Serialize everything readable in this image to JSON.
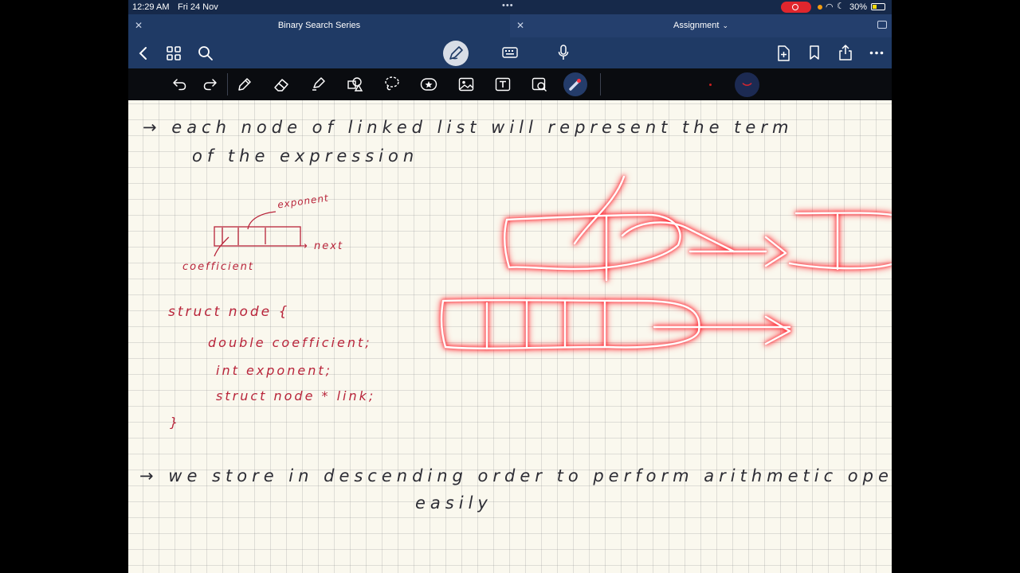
{
  "status_bar": {
    "time": "12:29 AM",
    "date": "Fri 24 Nov",
    "battery": "30%",
    "battery_level": 0.3
  },
  "tabs": [
    {
      "label": "Binary Search Series",
      "active": false
    },
    {
      "label": "Assignment",
      "active": true
    }
  ],
  "toolbar": {
    "icons": [
      "back-icon",
      "grid-icon",
      "search-icon",
      "pen-mode-icon",
      "keyboard-icon",
      "microphone-icon",
      "add-page-icon",
      "bookmark-icon",
      "share-icon",
      "more-icon"
    ]
  },
  "drawing_tools": {
    "icons": [
      "undo-icon",
      "redo-icon",
      "pencil-icon",
      "eraser-icon",
      "highlighter-icon",
      "shapes-icon",
      "lasso-icon",
      "sticker-icon",
      "image-icon",
      "textbox-icon",
      "camera-icon",
      "laser-pointer-icon"
    ],
    "colors": [
      "#c91f1f",
      "#1c2a52"
    ]
  },
  "notes": {
    "line1": "→ each node of linked list will represent the term",
    "line2": "of the expression",
    "label_exponent": "exponent",
    "label_next": "→ next",
    "label_coefficient": "coefficient",
    "code": [
      "struct node {",
      "double coefficient;",
      "int exponent;",
      "struct node * link;",
      "}"
    ],
    "line3": "→ we store in descending order to perform arithmetic operations",
    "line4": "easily"
  },
  "ink_colors": {
    "text": "#2c2c34",
    "red": "#b8243a",
    "laser": "#ff1a25"
  }
}
